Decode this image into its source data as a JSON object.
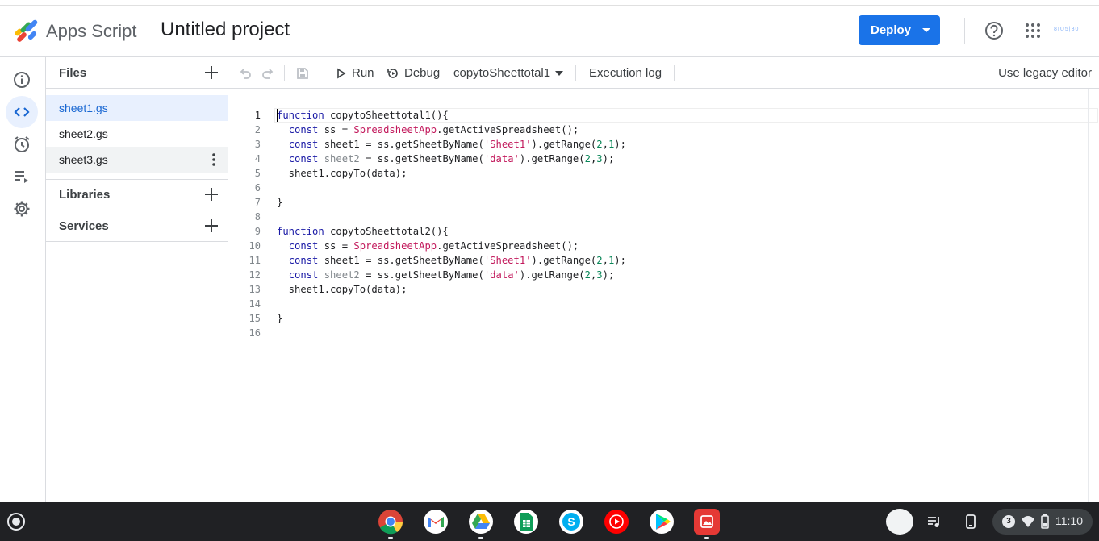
{
  "header": {
    "app_name": "Apps Script",
    "project_title": "Untitled project",
    "deploy_label": "Deploy",
    "account_label": "8IU5|30"
  },
  "rail": {
    "items": [
      "overview-icon",
      "editor-icon",
      "triggers-icon",
      "executions-icon",
      "settings-icon"
    ],
    "active": "editor-icon"
  },
  "files_panel": {
    "files_label": "Files",
    "files": [
      "sheet1.gs",
      "sheet2.gs",
      "sheet3.gs"
    ],
    "selected_file": "sheet1.gs",
    "libraries_label": "Libraries",
    "services_label": "Services"
  },
  "toolbar": {
    "run_label": "Run",
    "debug_label": "Debug",
    "function_select": "copytoSheettotal1",
    "execution_log_label": "Execution log",
    "legacy_label": "Use legacy editor"
  },
  "editor": {
    "line_numbers": [
      "1",
      "2",
      "3",
      "4",
      "5",
      "6",
      "7",
      "8",
      "9",
      "10",
      "11",
      "12",
      "13",
      "14",
      "15",
      "16"
    ],
    "current_line": "1",
    "lines": [
      "function copytoSheettotal1(){",
      "  const ss = SpreadsheetApp.getActiveSpreadsheet();",
      "  const sheet1 = ss.getSheetByName('Sheet1').getRange(2,1);",
      "  const sheet2 = ss.getSheetByName('data').getRange(2,3);",
      "  sheet1.copyTo(data);",
      "",
      "}",
      "",
      "function copytoSheettotal2(){",
      "  const ss = SpreadsheetApp.getActiveSpreadsheet();",
      "  const sheet1 = ss.getSheetByName('Sheet1').getRange(2,1);",
      "  const sheet2 = ss.getSheetByName('data').getRange(2,3);",
      "  sheet1.copyTo(data);",
      "",
      "}",
      ""
    ]
  },
  "shelf": {
    "apps": [
      "chrome-icon",
      "gmail-icon",
      "drive-icon",
      "sheets-icon",
      "skype-icon",
      "youtube-music-icon",
      "play-store-icon",
      "gallery-icon"
    ],
    "notification_count": "3",
    "time": "11:10"
  },
  "colors": {
    "accent": "#1a73e8",
    "selected_bg": "#e8f0fe",
    "keyword": "#1a1aa6",
    "string": "#c2185b",
    "number": "#098658",
    "shelf_bg": "#202124"
  }
}
